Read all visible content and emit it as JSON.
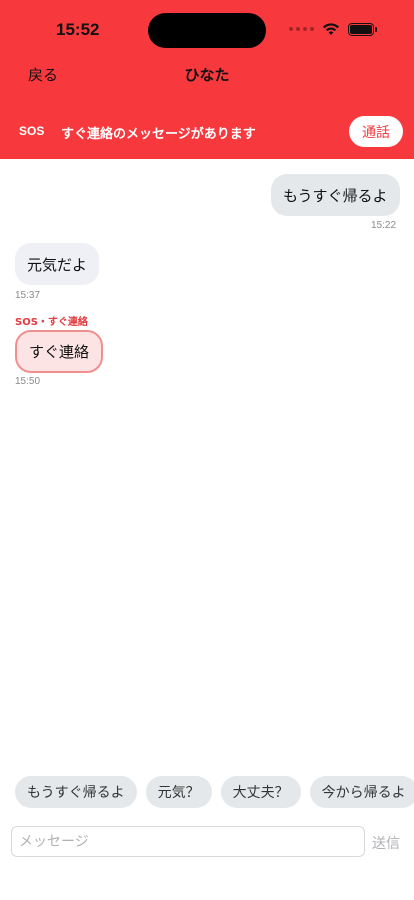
{
  "status_bar": {
    "time": "15:52",
    "icons": [
      "cellular-dots-icon",
      "wifi-icon",
      "battery-icon"
    ]
  },
  "header": {
    "back_label": "戻る",
    "title": "ひなた",
    "sos_tag": "SOS",
    "sos_message": "すぐ連絡のメッセージがあります",
    "call_label": "通話",
    "background_color": "#f7393e"
  },
  "messages": [
    {
      "direction": "outgoing",
      "text": "もうすぐ帰るよ",
      "time": "15:22"
    },
    {
      "direction": "incoming",
      "text": "元気だよ",
      "time": "15:37"
    },
    {
      "direction": "incoming",
      "label": "SOS・すぐ連絡",
      "text": "すぐ連絡",
      "time": "15:50",
      "sos": true
    }
  ],
  "quick_replies": [
    "もうすぐ帰るよ",
    "元気？",
    "大丈夫？",
    "今から帰るよ"
  ],
  "composer": {
    "placeholder": "メッセージ",
    "value": "",
    "send_label": "送信"
  }
}
